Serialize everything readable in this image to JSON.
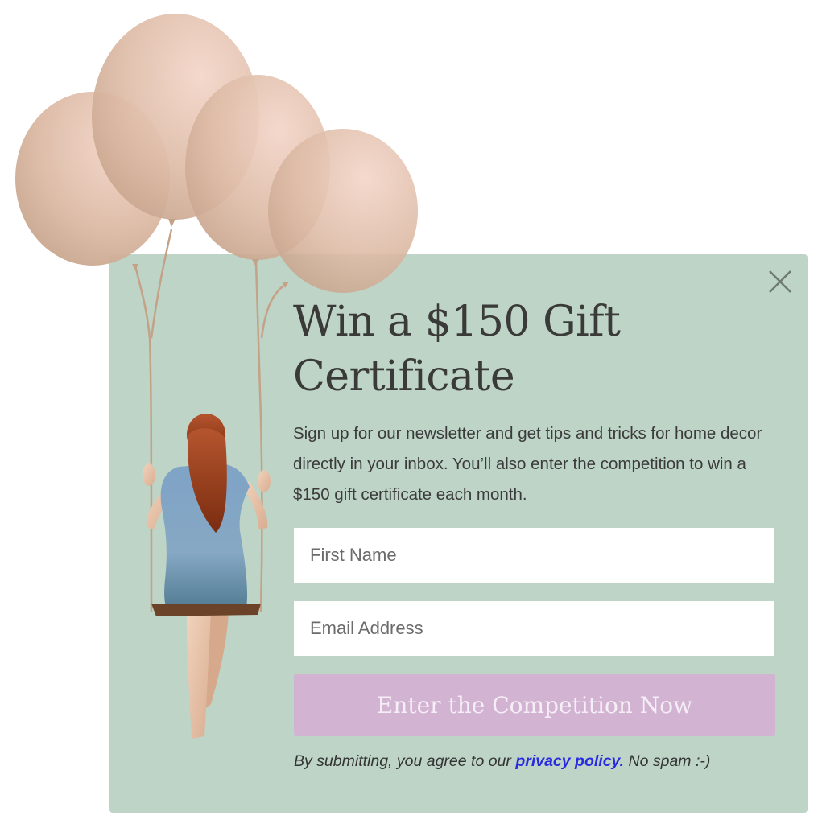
{
  "popup": {
    "headline_line1": "Win a $150 Gift",
    "headline_line2": "Certificate",
    "description": "Sign up for our newsletter and get tips and tricks for home decor directly in your inbox. You’ll also enter the competition to win a $150 gift certificate each month.",
    "first_name_placeholder": "First Name",
    "email_placeholder": "Email Address",
    "submit_label": "Enter the Competition Now",
    "disclaimer_prefix": "By submitting, you agree to our ",
    "privacy_link": "privacy policy.",
    "disclaimer_suffix": " No spam :-)",
    "close_icon": "close-icon"
  },
  "colors": {
    "popup_background": "#bdd4c6",
    "button_background": "#d2b4d2",
    "link": "#2a2ae0",
    "balloon": "#e8c5b2"
  },
  "illustration": {
    "subject": "girl on a swing held by four balloons"
  }
}
